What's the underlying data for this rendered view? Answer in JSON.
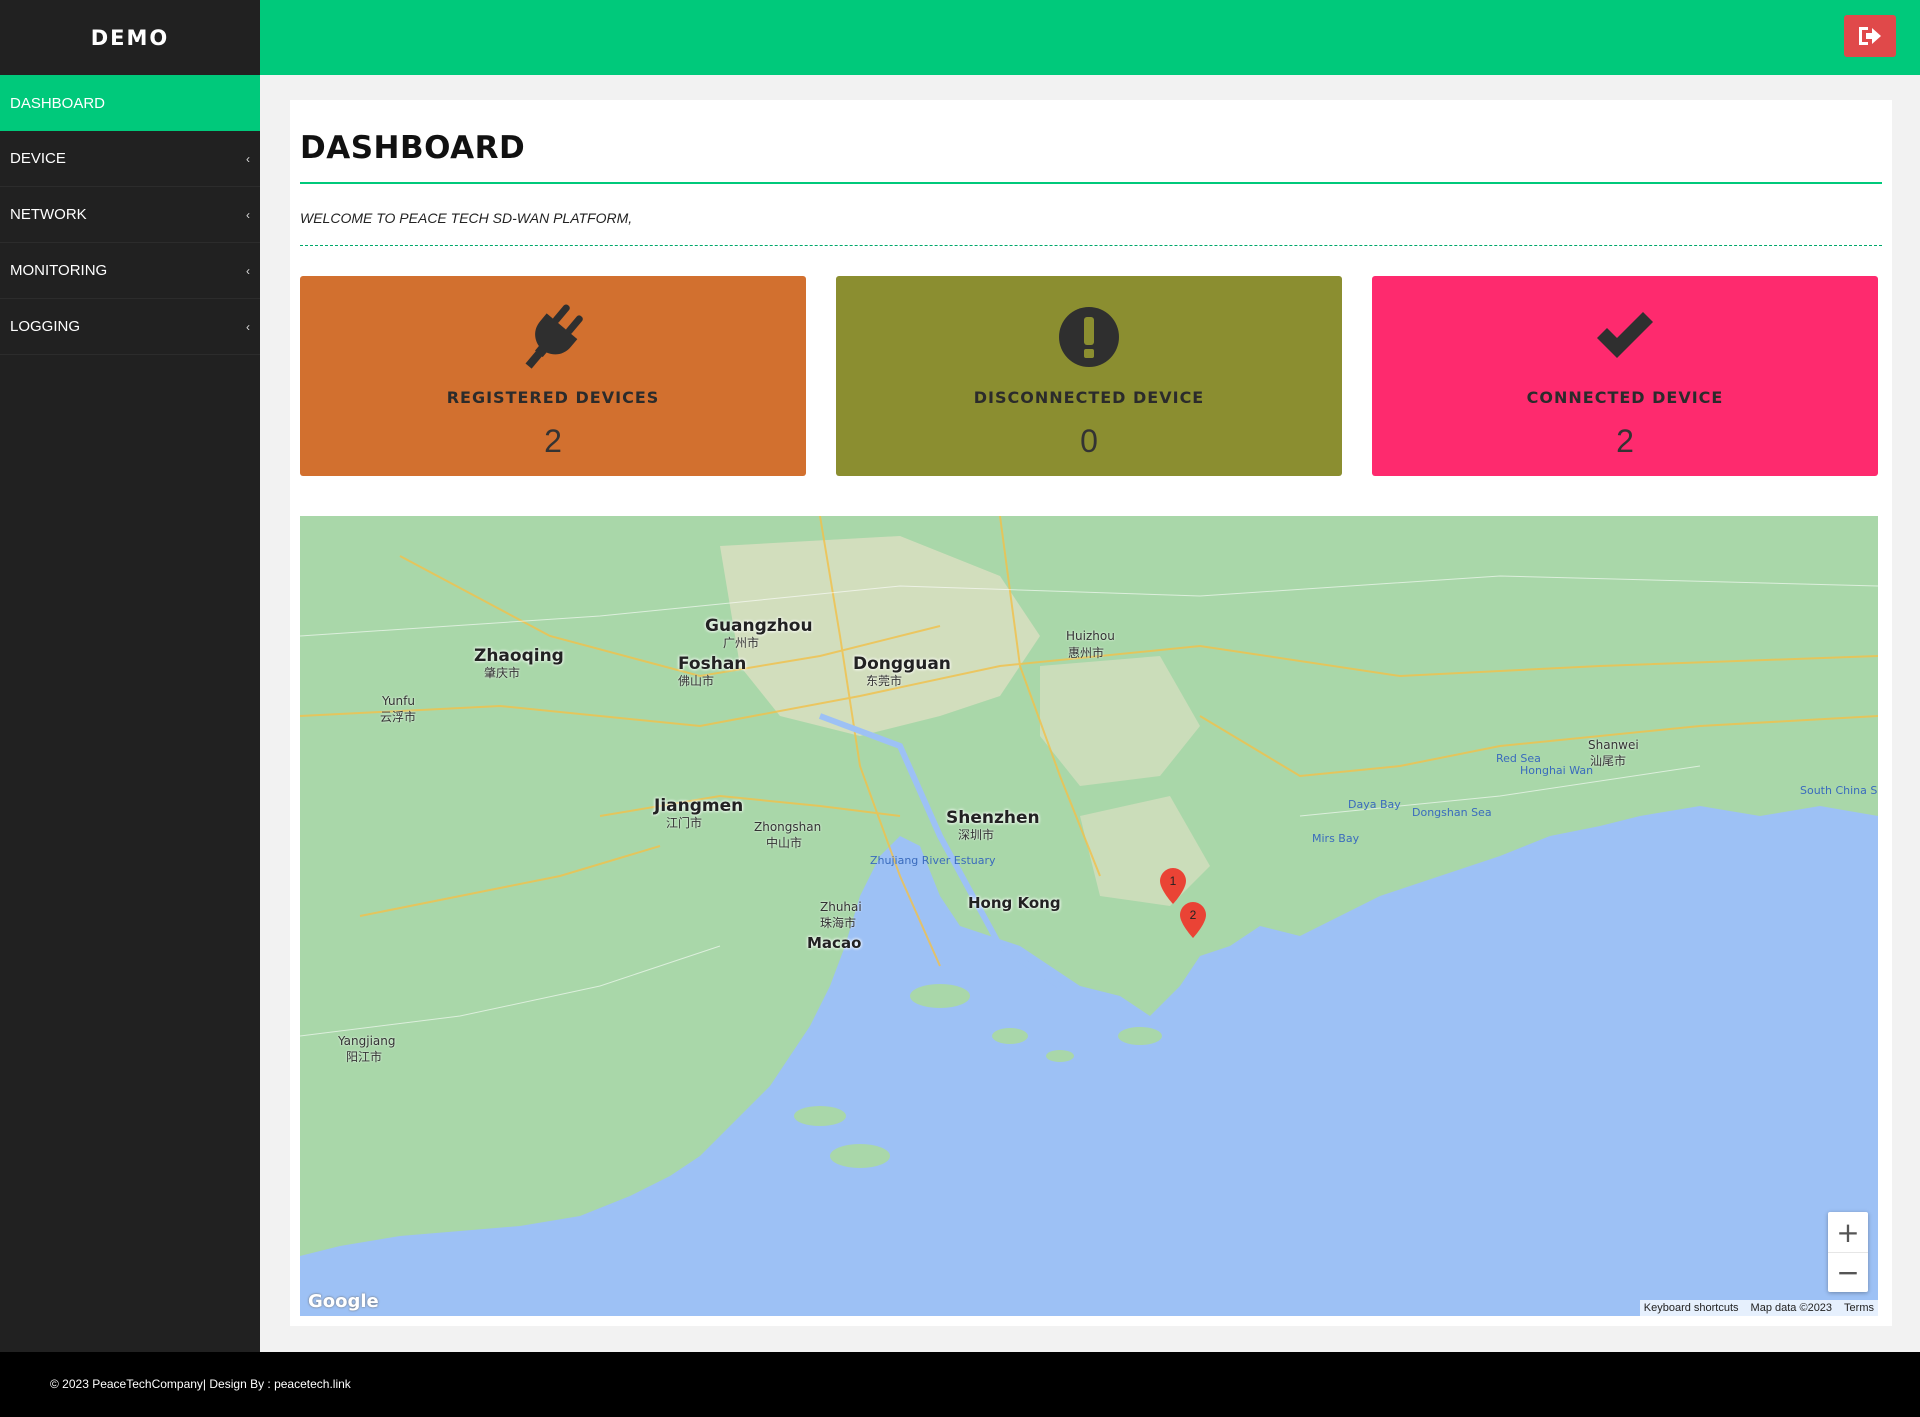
{
  "sidebar": {
    "brand": "DEMO",
    "items": [
      {
        "label": "DASHBOARD",
        "active": true
      },
      {
        "label": "DEVICE",
        "chevron": "‹"
      },
      {
        "label": "NETWORK",
        "chevron": "‹"
      },
      {
        "label": "MONITORING",
        "chevron": "‹"
      },
      {
        "label": "LOGGING",
        "chevron": "‹"
      }
    ]
  },
  "topbar": {
    "logout_icon": "sign-out-icon"
  },
  "main": {
    "title": "DASHBOARD",
    "welcome": "WELCOME TO PEACE TECH SD-WAN PLATFORM,"
  },
  "cards": [
    {
      "icon": "plug-icon",
      "label": "REGISTERED DEVICES",
      "count": "2",
      "color": "#d2702f"
    },
    {
      "icon": "exclamation-circle-icon",
      "label": "DISCONNECTED DEVICE",
      "count": "0",
      "color": "#8b8e30"
    },
    {
      "icon": "check-icon",
      "label": "CONNECTED DEVICE",
      "count": "2",
      "color": "#fe2a6e"
    }
  ],
  "map": {
    "cities": [
      "Guangzhou",
      "广州市",
      "Foshan",
      "佛山市",
      "Dongguan",
      "东莞市",
      "Zhaoqing",
      "肇庆市",
      "Huizhou",
      "惠州市",
      "Jiangmen",
      "江门市",
      "Shenzhen",
      "深圳市",
      "Zhongshan",
      "中山市",
      "Zhuhai",
      "珠海市",
      "Macao",
      "Hong Kong",
      "Yangjiang",
      "阳江市",
      "Shanwei",
      "汕尾市",
      "Yunfu",
      "云浮市"
    ],
    "water": [
      "South China Sea",
      "Honghai Wan",
      "Daya Bay",
      "Red Sea",
      "Dongshan Sea",
      "Mirs Bay",
      "Zhujiang River Estuary"
    ],
    "markers": [
      "1",
      "2"
    ],
    "zoom_in": "+",
    "zoom_out": "−",
    "keyboard_shortcuts": "Keyboard shortcuts",
    "map_data": "Map data ©2023",
    "terms": "Terms",
    "logo": "Google"
  },
  "footer": {
    "text": "© 2023 PeaceTechCompany| Design By : peacetech.link"
  }
}
